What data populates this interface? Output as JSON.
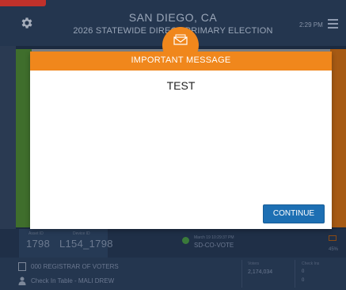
{
  "header": {
    "city": "SAN DIEGO, CA",
    "election": "2026 STATEWIDE DIRECT PRIMARY ELECTION",
    "time": "2:29 PM"
  },
  "status": {
    "asset_label": "Asset ID",
    "asset_id": "1798",
    "device_label": "Device ID",
    "device_id": "L154_1798",
    "vote_datetime": "March 19 10:29:37 PM",
    "vote_code": "SD-CO-VOTE",
    "percent": "45%"
  },
  "footer": {
    "registrar": "000 REGISTRAR OF VOTERS",
    "check_in_table": "Check In Table - MALI DREW",
    "voters_label": "Voters",
    "voters_value": "2,174,034",
    "checkins_label": "Check Ins",
    "checkins_a": "0",
    "checkins_b": "0"
  },
  "modal": {
    "title": "IMPORTANT MESSAGE",
    "message": "TEST",
    "continue_label": "CONTINUE"
  },
  "icons": {
    "settings": "gear-icon",
    "menu": "hamburger-icon",
    "message": "envelope-icon",
    "registrar": "document-icon",
    "user": "person-icon"
  },
  "colors": {
    "accent_orange": "#f0871c",
    "button_blue": "#1d6fb3",
    "header_navy": "#24364f"
  }
}
